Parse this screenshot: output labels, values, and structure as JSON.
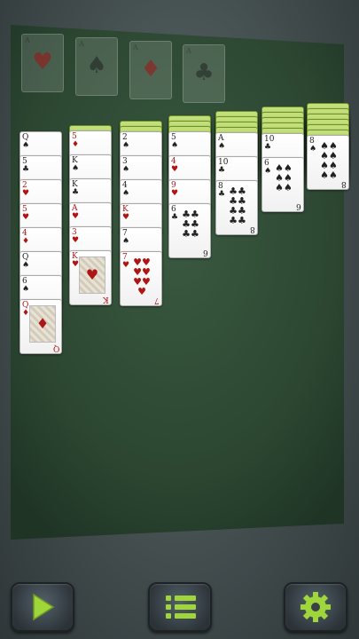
{
  "foundations": [
    {
      "rank": "A",
      "suit": "♥",
      "color": "red"
    },
    {
      "rank": "A",
      "suit": "♠",
      "color": "black"
    },
    {
      "rank": "A",
      "suit": "♦",
      "color": "red"
    },
    {
      "rank": "A",
      "suit": "♣",
      "color": "black"
    }
  ],
  "tableau": [
    {
      "hidden": 0,
      "cards": [
        {
          "rank": "Q",
          "suit": "♠"
        },
        {
          "rank": "5",
          "suit": "♣"
        },
        {
          "rank": "2",
          "suit": "♥"
        },
        {
          "rank": "5",
          "suit": "♥"
        },
        {
          "rank": "4",
          "suit": "♦"
        },
        {
          "rank": "Q",
          "suit": "♠"
        },
        {
          "rank": "6",
          "suit": "♠"
        },
        {
          "rank": "Q",
          "suit": "♦"
        }
      ]
    },
    {
      "hidden": 1,
      "cards": [
        {
          "rank": "5",
          "suit": "♦"
        },
        {
          "rank": "K",
          "suit": "♠"
        },
        {
          "rank": "K",
          "suit": "♣"
        },
        {
          "rank": "A",
          "suit": "♥"
        },
        {
          "rank": "3",
          "suit": "♥"
        },
        {
          "rank": "K",
          "suit": "♥"
        }
      ]
    },
    {
      "hidden": 2,
      "cards": [
        {
          "rank": "2",
          "suit": "♠"
        },
        {
          "rank": "3",
          "suit": "♠"
        },
        {
          "rank": "4",
          "suit": "♠"
        },
        {
          "rank": "K",
          "suit": "♥"
        },
        {
          "rank": "7",
          "suit": "♠"
        },
        {
          "rank": "7",
          "suit": "♥"
        }
      ]
    },
    {
      "hidden": 3,
      "cards": [
        {
          "rank": "5",
          "suit": "♠"
        },
        {
          "rank": "4",
          "suit": "♥"
        },
        {
          "rank": "9",
          "suit": "♥"
        },
        {
          "rank": "6",
          "suit": "♣"
        }
      ]
    },
    {
      "hidden": 4,
      "cards": [
        {
          "rank": "A",
          "suit": "♠"
        },
        {
          "rank": "10",
          "suit": "♣"
        },
        {
          "rank": "8",
          "suit": "♣"
        }
      ]
    },
    {
      "hidden": 5,
      "cards": [
        {
          "rank": "10",
          "suit": "♣"
        },
        {
          "rank": "6",
          "suit": "♠"
        }
      ]
    },
    {
      "hidden": 6,
      "cards": [
        {
          "rank": "8",
          "suit": "♠"
        }
      ]
    }
  ],
  "toolbar": [
    {
      "icon": "play-icon"
    },
    {
      "icon": "menu-list-icon"
    },
    {
      "icon": "gear-icon"
    }
  ],
  "colors": {
    "felt": "#2f4a34",
    "card_back": "#a8cb52",
    "red_suit": "#b01515",
    "icon_green": "#9fd63a"
  }
}
